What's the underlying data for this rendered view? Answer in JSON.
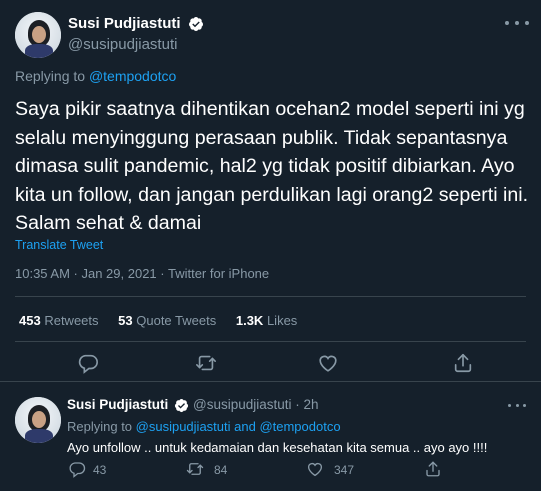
{
  "main_tweet": {
    "author_name": "Susi Pudjiastuti",
    "handle": "@susipudjiastuti",
    "replying_prefix": "Replying to ",
    "replying_to": "@tempodotco",
    "text": "Saya pikir saatnya dihentikan ocehan2 model seperti ini yg selalu menyinggung perasaan publik. Tidak sepantasnya dimasa sulit pandemic, hal2 yg tidak positif dibiarkan. Ayo kita un follow, dan jangan perdulikan lagi orang2 seperti ini. Salam sehat & damai",
    "translate_label": "Translate Tweet",
    "meta": "10:35 AM · Jan 29, 2021 · Twitter for iPhone",
    "stats": {
      "retweets_count": "453",
      "retweets_label": "Retweets",
      "quotes_count": "53",
      "quotes_label": "Quote Tweets",
      "likes_count": "1.3K",
      "likes_label": "Likes"
    }
  },
  "reply_tweet": {
    "author_name": "Susi Pudjiastuti",
    "handle_time": "@susipudjiastuti · 2h",
    "replying_prefix": "Replying to ",
    "replying_to_1": "@susipudjiastuti",
    "replying_and": " and ",
    "replying_to_2": "@tempodotco",
    "text": "Ayo unfollow .. untuk kedamaian dan kesehatan kita semua .. ayo ayo !!!!",
    "reply_count": "43",
    "retweet_count": "84",
    "like_count": "347"
  },
  "colors": {
    "background": "#15202b",
    "accent": "#1da1f2",
    "secondary_text": "#8899a6",
    "divider": "#38444d"
  },
  "icons": [
    "verified-badge-icon",
    "more-icon",
    "reply-icon",
    "retweet-icon",
    "like-icon",
    "share-icon"
  ]
}
